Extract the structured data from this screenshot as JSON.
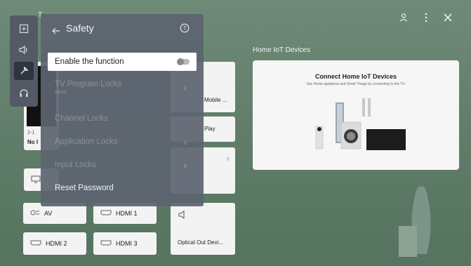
{
  "header": {
    "partial_letter": "T",
    "account_icon": "person-icon",
    "more_icon": "vertical-dots-icon",
    "close_icon": "close-icon"
  },
  "rail": {
    "items": [
      {
        "icon": "picture-icon"
      },
      {
        "icon": "speaker-icon"
      },
      {
        "icon": "wrench-icon"
      },
      {
        "icon": "headset-icon"
      }
    ]
  },
  "safety": {
    "title": "Safety",
    "back_icon": "back-arrow-icon",
    "help_icon": "help-icon",
    "items": [
      {
        "label": "Enable the function",
        "type": "toggle",
        "state": "off"
      },
      {
        "label": "TV Program Locks",
        "sub": "None",
        "enabled": false
      },
      {
        "label": "Channel Locks",
        "enabled": false
      },
      {
        "label": "Application Locks",
        "enabled": false
      },
      {
        "label": "Input Locks",
        "enabled": false
      },
      {
        "label": "Reset Password",
        "enabled": true
      }
    ]
  },
  "background": {
    "channel_number": "2-1",
    "channel_name": "No I",
    "tile_mobile": "Mobile ...",
    "tile_play": "Play",
    "inputs": [
      {
        "label": "AV",
        "icon": "av-icon"
      },
      {
        "label": "HDMI 1",
        "icon": "hdmi-icon"
      },
      {
        "label": "HDMI 2",
        "icon": "hdmi-icon"
      },
      {
        "label": "HDMI 3",
        "icon": "hdmi-icon"
      },
      {
        "label": "Optical Out Devi...",
        "icon": "speaker-icon"
      }
    ]
  },
  "iot": {
    "section_title": "Home IoT Devices",
    "card_title": "Connect Home IoT Devices",
    "card_subtitle": "Use Home appliance and Small Things by connecting to the TV."
  },
  "colors": {
    "background": "#64816d",
    "menu": "#5c6470",
    "tile": "#f3f3f3"
  }
}
